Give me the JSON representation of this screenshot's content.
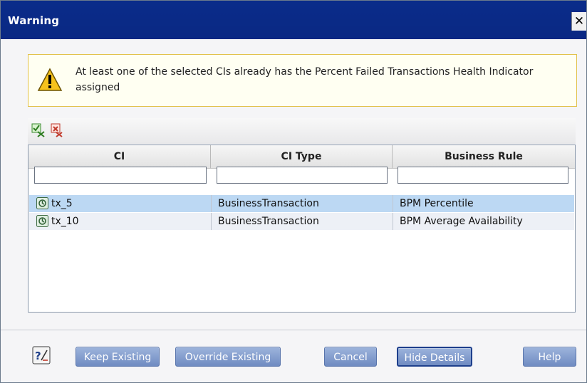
{
  "window": {
    "title": "Warning",
    "close_glyph": "✕"
  },
  "warning": {
    "message": "At least one of the selected CIs already has the Percent Failed Transactions Health Indicator assigned",
    "icon": "warning-triangle-icon"
  },
  "toolbar": {
    "icons": [
      "select-all-icon",
      "clear-selection-icon"
    ]
  },
  "table": {
    "columns": [
      "CI",
      "CI Type",
      "Business Rule"
    ],
    "filters": [
      "",
      "",
      ""
    ],
    "rows": [
      {
        "ci": "tx_5",
        "ci_type": "BusinessTransaction",
        "business_rule": "BPM Percentile",
        "selected": true
      },
      {
        "ci": "tx_10",
        "ci_type": "BusinessTransaction",
        "business_rule": "BPM Average Availability",
        "selected": false
      }
    ]
  },
  "buttons": {
    "keep": "Keep Existing",
    "override": "Override Existing",
    "cancel": "Cancel",
    "hide_details": "Hide Details",
    "help": "Help"
  },
  "colors": {
    "title_bar": "#0a2c8a",
    "selected_row": "#bcd8f3",
    "button": "#7f98cb",
    "warning_border": "#e2c24b"
  }
}
